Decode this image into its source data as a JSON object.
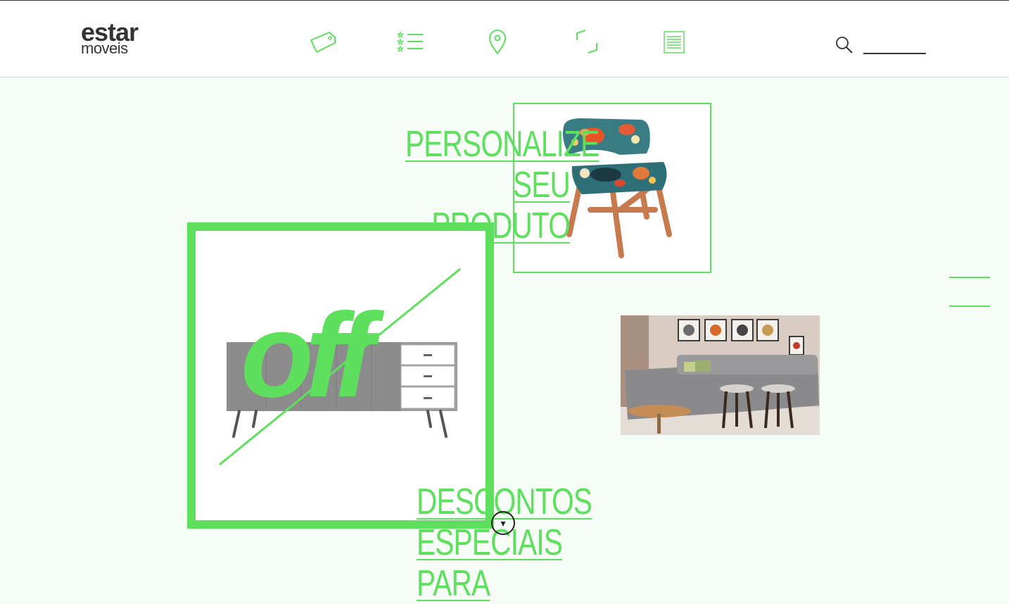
{
  "brand": {
    "line1": "estar",
    "line2": "moveis"
  },
  "nav": [
    {
      "name": "promocoes",
      "icon": "price-tag-icon"
    },
    {
      "name": "favoritos",
      "icon": "star-list-icon"
    },
    {
      "name": "lojas",
      "icon": "map-pin-icon"
    },
    {
      "name": "ambientes",
      "icon": "corner-frame-icon"
    },
    {
      "name": "catalogo",
      "icon": "document-lines-icon"
    }
  ],
  "search": {
    "placeholder": "",
    "value": "",
    "icon": "search-icon"
  },
  "hero": {
    "personalize_line1": "PERSONALIZE",
    "personalize_line2": "SEU PRODUTO",
    "off_label": "off",
    "descontos_line1": "DESCONTOS",
    "descontos_line2": "ESPECIAIS PARA"
  },
  "colors": {
    "accent": "#5ee05e",
    "text": "#333333",
    "background": "#f6fcf6"
  },
  "scroll_button": "▾"
}
